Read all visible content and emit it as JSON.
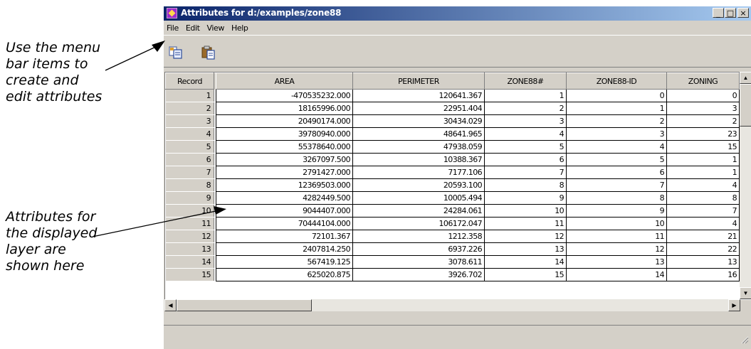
{
  "callouts": {
    "menu_bar": "Use the menu\nbar items to\ncreate and\nedit attributes",
    "table": "Attributes for\nthe displayed\nlayer are\nshown here"
  },
  "window": {
    "title": "Attributes for d:/examples/zone88",
    "controls": {
      "minimize": "_",
      "maximize": "□",
      "close": "×"
    }
  },
  "menu": [
    "File",
    "Edit",
    "View",
    "Help"
  ],
  "toolbar": {
    "icons": [
      "copy-icon",
      "paste-icon"
    ]
  },
  "table": {
    "columns": [
      "Record",
      "AREA",
      "PERIMETER",
      "ZONE88#",
      "ZONE88-ID",
      "ZONING"
    ],
    "rows": [
      [
        "1",
        "-470535232.000",
        "120641.367",
        "1",
        "0",
        "0"
      ],
      [
        "2",
        "18165996.000",
        "22951.404",
        "2",
        "1",
        "3"
      ],
      [
        "3",
        "20490174.000",
        "30434.029",
        "3",
        "2",
        "2"
      ],
      [
        "4",
        "39780940.000",
        "48641.965",
        "4",
        "3",
        "23"
      ],
      [
        "5",
        "55378640.000",
        "47938.059",
        "5",
        "4",
        "15"
      ],
      [
        "6",
        "3267097.500",
        "10388.367",
        "6",
        "5",
        "1"
      ],
      [
        "7",
        "2791427.000",
        "7177.106",
        "7",
        "6",
        "1"
      ],
      [
        "8",
        "12369503.000",
        "20593.100",
        "8",
        "7",
        "4"
      ],
      [
        "9",
        "4282449.500",
        "10005.494",
        "9",
        "8",
        "8"
      ],
      [
        "10",
        "9044407.000",
        "24284.061",
        "10",
        "9",
        "7"
      ],
      [
        "11",
        "70444104.000",
        "106172.047",
        "11",
        "10",
        "4"
      ],
      [
        "12",
        "72101.367",
        "1212.358",
        "12",
        "11",
        "21"
      ],
      [
        "13",
        "2407814.250",
        "6937.226",
        "13",
        "12",
        "22"
      ],
      [
        "14",
        "567419.125",
        "3078.611",
        "14",
        "13",
        "13"
      ],
      [
        "15",
        "625020.875",
        "3926.702",
        "15",
        "14",
        "16"
      ]
    ]
  }
}
